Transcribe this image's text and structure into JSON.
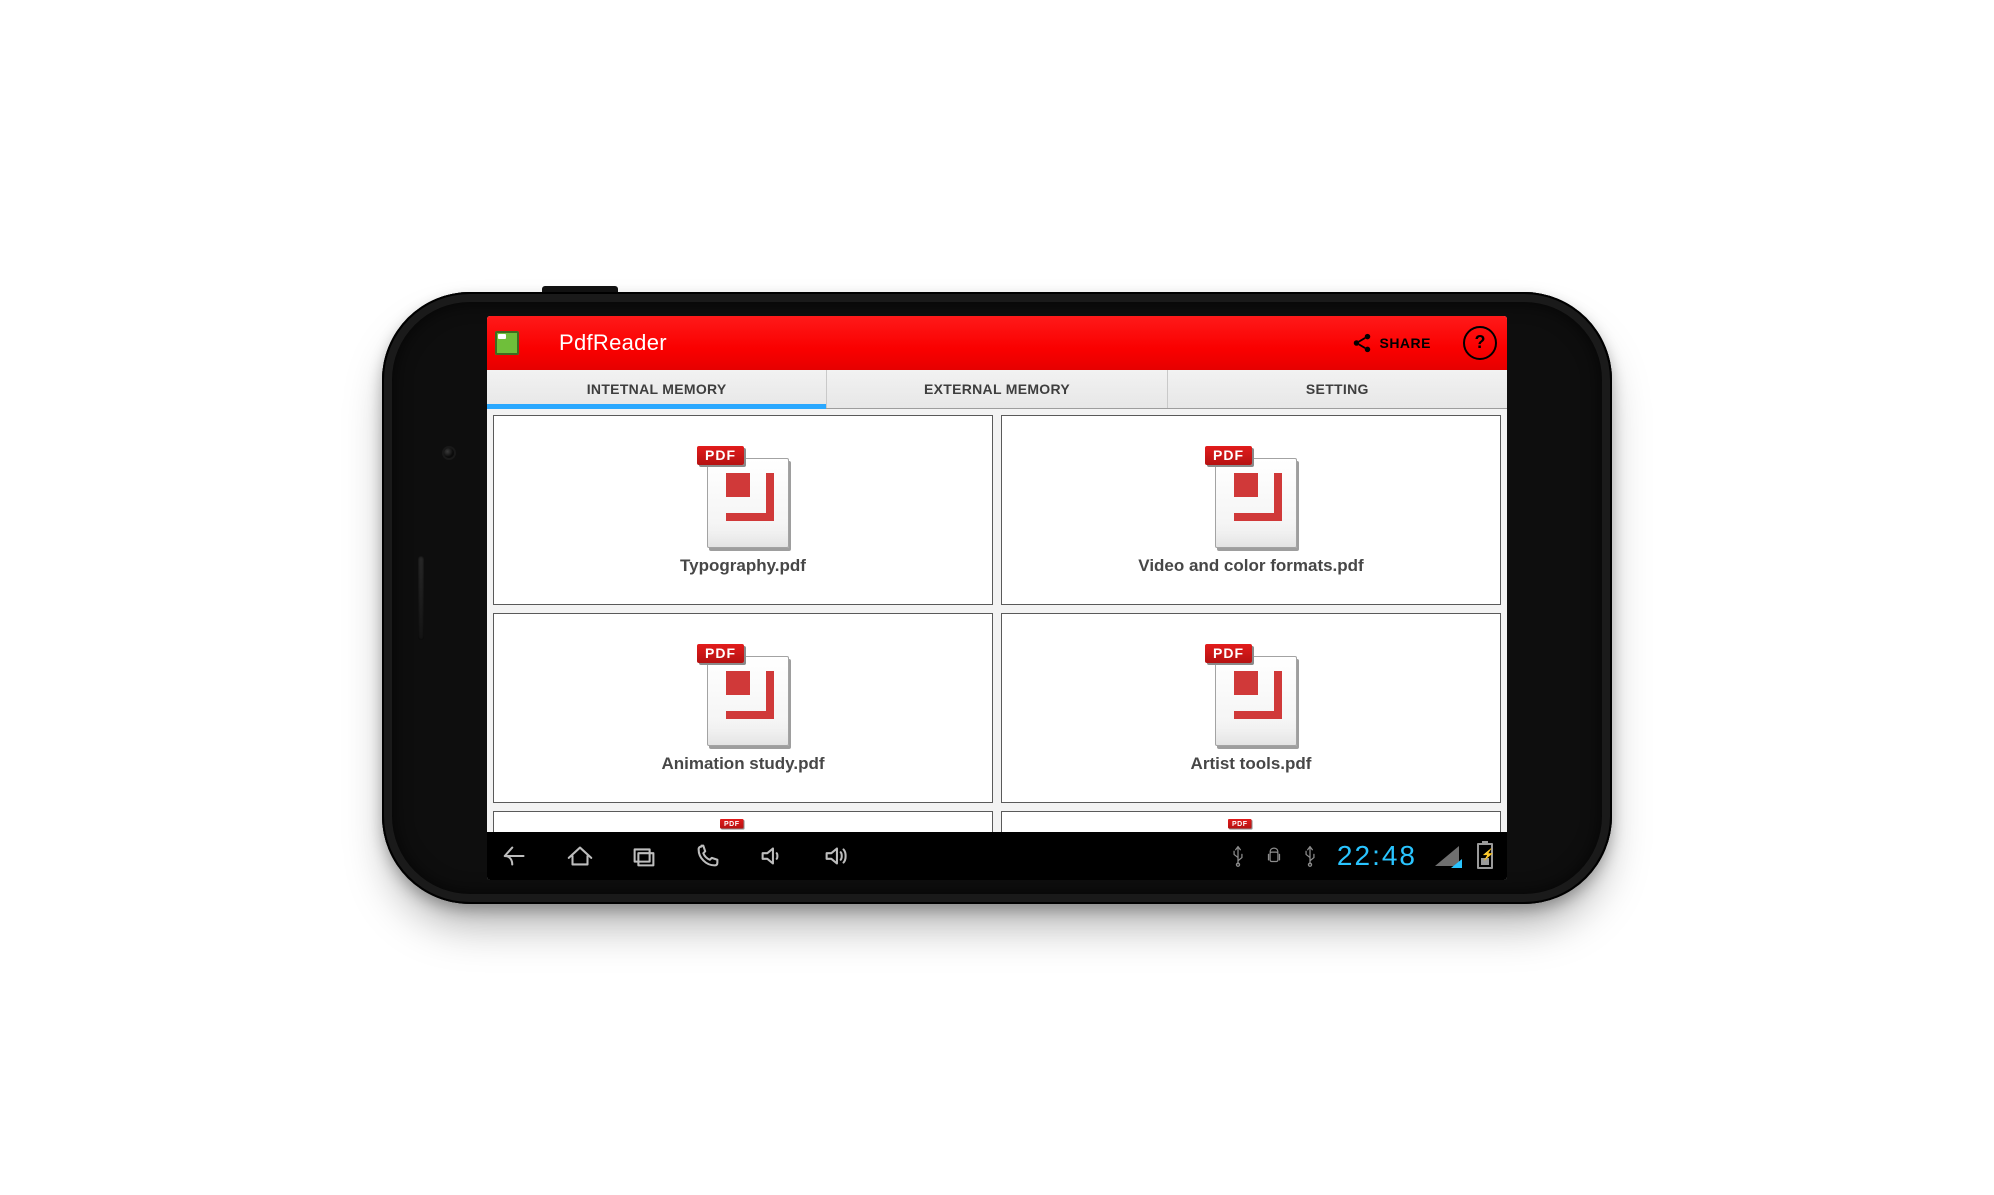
{
  "actionbar": {
    "title": "PdfReader",
    "share_label": "SHARE",
    "help_glyph": "?"
  },
  "tabs": [
    {
      "label": "INTETNAL MEMORY",
      "active": true
    },
    {
      "label": "EXTERNAL MEMORY",
      "active": false
    },
    {
      "label": "SETTING",
      "active": false
    }
  ],
  "pdf_badge": "PDF",
  "files": [
    {
      "name": "Typography.pdf"
    },
    {
      "name": "Video and color formats.pdf"
    },
    {
      "name": "Animation study.pdf"
    },
    {
      "name": "Artist tools.pdf"
    }
  ],
  "sysbar": {
    "clock": "22:48"
  }
}
